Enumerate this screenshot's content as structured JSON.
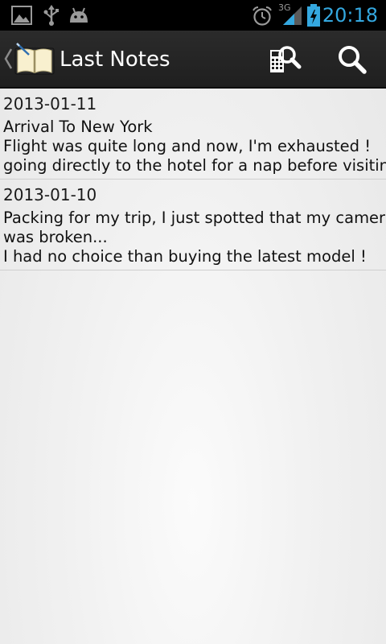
{
  "status_bar": {
    "time": "20:18",
    "network": "3G",
    "icons": [
      "gallery-icon",
      "usb-icon",
      "android-icon",
      "alarm-icon",
      "signal-icon",
      "battery-charging-icon"
    ],
    "accent_color": "#34a8e0"
  },
  "action_bar": {
    "title": "Last Notes",
    "icons": [
      "app-notebook-icon",
      "calculator-search-icon",
      "search-icon"
    ]
  },
  "notes": [
    {
      "date": "2013-01-11",
      "lines": [
        "Arrival To New York",
        "Flight was quite long and now, I'm exhausted !",
        "going directly to the hotel for a nap before visiting"
      ]
    },
    {
      "date": "2013-01-10",
      "lines": [
        "Packing for my trip, I just spotted that my camera",
        "was broken...",
        "I had no choice than buying the latest model !"
      ]
    }
  ]
}
